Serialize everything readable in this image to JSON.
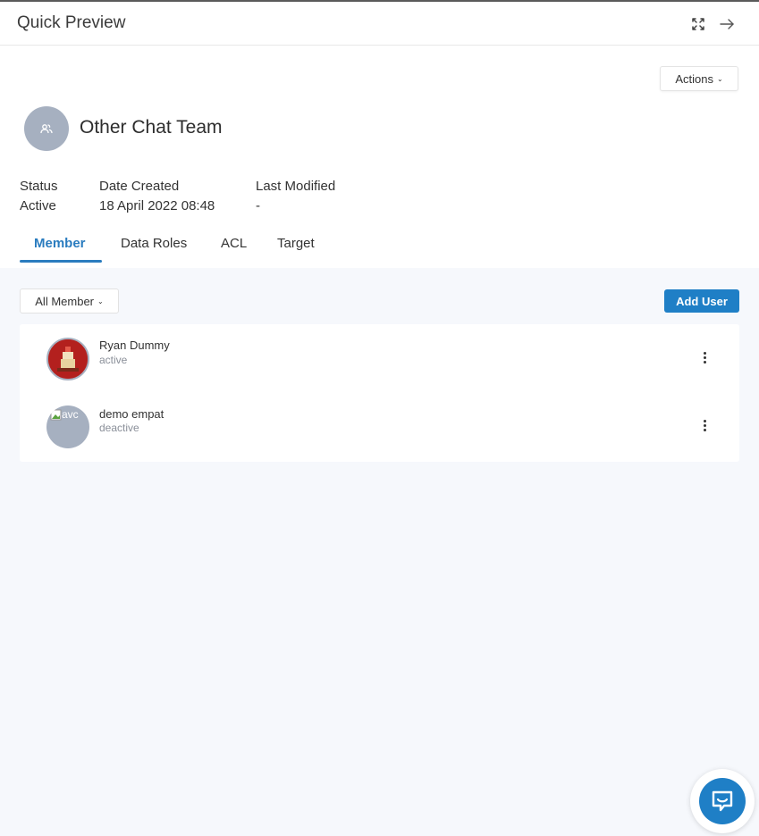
{
  "header": {
    "title": "Quick Preview"
  },
  "actions": {
    "label": "Actions"
  },
  "team": {
    "name": "Other Chat Team"
  },
  "meta": {
    "status_label": "Status",
    "status_value": "Active",
    "date_created_label": "Date Created",
    "date_created_value": "18 April 2022 08:48",
    "last_modified_label": "Last Modified",
    "last_modified_value": "-"
  },
  "tabs": [
    {
      "label": "Member",
      "active": true
    },
    {
      "label": "Data Roles",
      "active": false
    },
    {
      "label": "ACL",
      "active": false
    },
    {
      "label": "Target",
      "active": false
    }
  ],
  "filter": {
    "label": "All Member"
  },
  "add_user": {
    "label": "Add User"
  },
  "members": [
    {
      "name": "Ryan Dummy",
      "status": "active"
    },
    {
      "name": "demo empat",
      "status": "deactive",
      "broken_alt": "avc"
    }
  ],
  "colors": {
    "accent": "#1f7fc6",
    "avatar_bg": "#a6b0c0",
    "content_bg": "#f6f8fc"
  }
}
